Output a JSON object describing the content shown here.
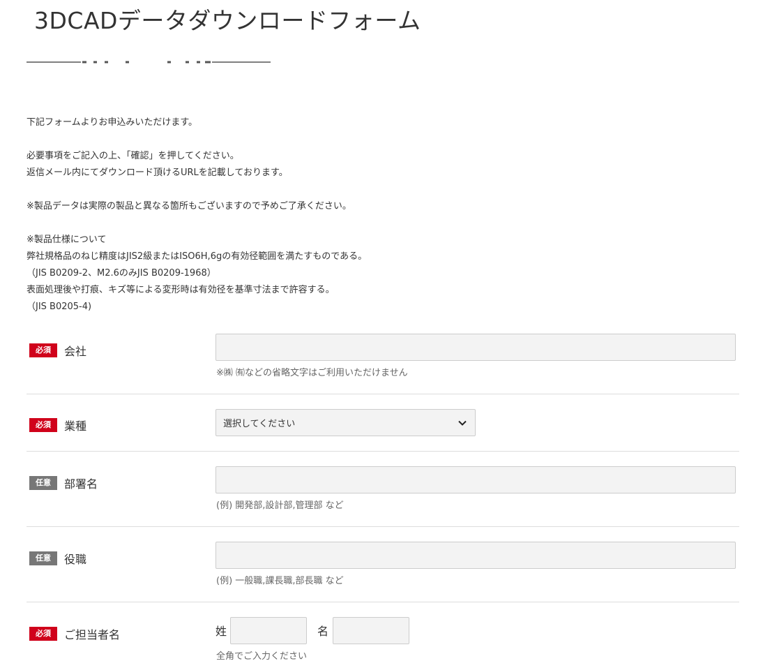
{
  "page": {
    "title": "3DCADデータダウンロードフォーム"
  },
  "intro": {
    "line1": "下記フォームよりお申込みいただけます。",
    "line2": "必要事項をご記入の上、「確認」を押してください。",
    "line3": "返信メール内にてダウンロード頂けるURLを記載しております。",
    "line4": "※製品データは実際の製品と異なる箇所もございますので予めご了承ください。",
    "line5": "※製品仕様について",
    "line6": "弊社規格品のねじ精度はJIS2級またはISO6H,6gの有効径範囲を満たすものである。",
    "line7": "（JIS B0209-2、M2.6のみJIS B0209-1968）",
    "line8": "表面処理後や打痕、キズ等による変形時は有効径を基準寸法まで許容する。",
    "line9": "（JIS B0205-4)"
  },
  "badges": {
    "required": "必須",
    "optional": "任意"
  },
  "fields": {
    "company": {
      "label": "会社",
      "value": "",
      "hint": "※㈱ ㈲などの省略文字はご利用いただけません"
    },
    "industry": {
      "label": "業種",
      "selected": "選択してください"
    },
    "department": {
      "label": "部署名",
      "value": "",
      "hint": "(例) 開発部,設計部,管理部 など"
    },
    "position": {
      "label": "役職",
      "value": "",
      "hint": "(例) 一般職,課長職,部長職 など"
    },
    "contact_name": {
      "label": "ご担当者名",
      "last_name_label": "姓",
      "first_name_label": "名",
      "last_name_value": "",
      "first_name_value": "",
      "hint": "全角でご入力ください"
    }
  },
  "colors": {
    "required_badge": "#d0021b",
    "optional_badge": "#777777",
    "input_bg": "#f3f3f3"
  }
}
